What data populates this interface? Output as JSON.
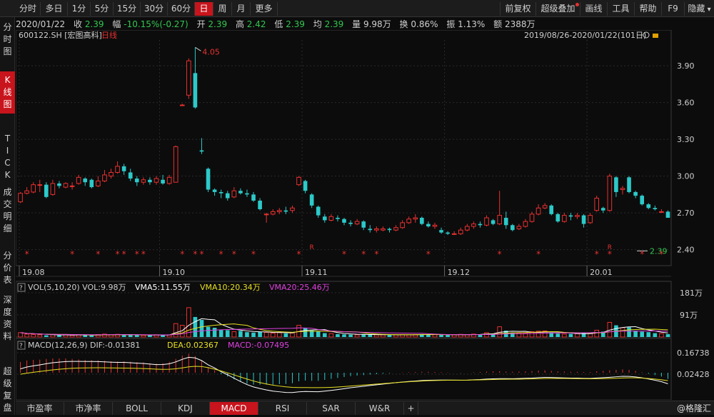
{
  "toolbar": {
    "left": [
      {
        "label": "分时",
        "active": false
      },
      {
        "label": "多日",
        "active": false
      },
      {
        "label": "1分",
        "active": false
      },
      {
        "label": "5分",
        "active": false
      },
      {
        "label": "15分",
        "active": false
      },
      {
        "label": "30分",
        "active": false
      },
      {
        "label": "60分",
        "active": false
      },
      {
        "label": "日",
        "active": true
      },
      {
        "label": "周",
        "active": false
      },
      {
        "label": "月",
        "active": false
      },
      {
        "label": "更多",
        "active": false
      }
    ],
    "right": [
      {
        "label": "前复权"
      },
      {
        "label": "超级叠加"
      },
      {
        "label": "画线"
      },
      {
        "label": "工具"
      },
      {
        "label": "帮助"
      },
      {
        "label": "F9"
      },
      {
        "label": "隐藏"
      }
    ]
  },
  "sidebar": [
    {
      "label": "分时图",
      "active": false
    },
    {
      "label": "K线图",
      "active": true
    },
    {
      "label": "TICK",
      "active": false
    },
    {
      "label": "成交明细",
      "active": false
    },
    {
      "label": "分价表",
      "active": false
    },
    {
      "label": "深度资料",
      "active": false
    },
    {
      "label": "超级复盘",
      "active": false
    }
  ],
  "info": {
    "date": "2020/01/22",
    "close_label": "收",
    "close": "2.39",
    "change_label": "幅",
    "change": "-10.15%(-0.27)",
    "open_label": "开",
    "open": "2.39",
    "high_label": "高",
    "high": "2.42",
    "low_label": "低",
    "low": "2.39",
    "avg_label": "均",
    "avg": "2.39",
    "vol_label": "量",
    "vol": "9.98万",
    "turnover_label": "换",
    "turnover": "0.86%",
    "amp_label": "振",
    "amp": "1.13%",
    "amount_label": "额",
    "amount": "2388万"
  },
  "price_panel": {
    "code": "600122.SH",
    "name": "[宏图高科]",
    "period": "日线",
    "range": "2019/08/26-2020/01/22(101日)",
    "peak_label": "4.05",
    "last_label": "2.39",
    "event_marker_r": "R",
    "event_marker_star": "*"
  },
  "vol_header": {
    "title": "VOL(5,10,20)",
    "vol": "VOL:9.98万",
    "vma5": "VMA5:11.55万",
    "vma10": "VMA10:20.34万",
    "vma20": "VMA20:25.46万"
  },
  "macd_header": {
    "title": "MACD(12,26,9)",
    "dif": "DIF:-0.01381",
    "dea": "DEA:0.02367",
    "macd": "MACD:-0.07495"
  },
  "bottom_tabs": [
    {
      "label": "市盈率",
      "active": false
    },
    {
      "label": "市净率",
      "active": false
    },
    {
      "label": "BOLL",
      "active": false
    },
    {
      "label": "KDJ",
      "active": false
    },
    {
      "label": "MACD",
      "active": true
    },
    {
      "label": "RSI",
      "active": false
    },
    {
      "label": "SAR",
      "active": false
    },
    {
      "label": "W&R",
      "active": false
    }
  ],
  "watermark": "@格隆汇",
  "colors": {
    "up": "#e83030",
    "down": "#2dc9c9",
    "active": "#c8141c",
    "green": "#32c650"
  },
  "chart_data": [
    {
      "type": "candlestick",
      "title": "600122.SH [宏图高科] 日线",
      "x_labels": [
        "19.08",
        "19.10",
        "19.11",
        "19.12",
        "20.01"
      ],
      "y_ticks": [
        "3.90",
        "3.60",
        "3.30",
        "3.00",
        "2.70",
        "2.40"
      ],
      "ylim": [
        2.27,
        4.11
      ],
      "candles": [
        [
          2.79,
          2.86,
          2.78,
          2.87
        ],
        [
          2.86,
          2.88,
          2.85,
          2.91
        ],
        [
          2.87,
          2.93,
          2.86,
          2.95
        ],
        [
          2.93,
          2.93,
          2.87,
          2.97
        ],
        [
          2.93,
          2.83,
          2.82,
          2.95
        ],
        [
          2.85,
          2.94,
          2.84,
          2.97
        ],
        [
          2.94,
          2.92,
          2.9,
          2.96
        ],
        [
          2.91,
          2.94,
          2.9,
          2.95
        ],
        [
          2.92,
          2.92,
          2.89,
          2.95
        ],
        [
          2.94,
          2.99,
          2.93,
          3.01
        ],
        [
          2.98,
          2.95,
          2.92,
          2.99
        ],
        [
          2.97,
          2.91,
          2.9,
          2.98
        ],
        [
          2.92,
          2.96,
          2.91,
          3.0
        ],
        [
          2.96,
          3.01,
          2.95,
          3.05
        ],
        [
          3.0,
          3.03,
          2.98,
          3.06
        ],
        [
          3.03,
          3.08,
          3.02,
          3.12
        ],
        [
          3.08,
          3.04,
          3.01,
          3.1
        ],
        [
          3.03,
          2.98,
          2.96,
          3.06
        ],
        [
          2.98,
          2.95,
          2.92,
          3.0
        ],
        [
          2.95,
          2.97,
          2.93,
          2.99
        ],
        [
          2.97,
          2.95,
          2.93,
          2.99
        ],
        [
          2.95,
          2.98,
          2.93,
          3.0
        ],
        [
          2.97,
          2.94,
          2.93,
          3.01
        ],
        [
          2.94,
          2.99,
          2.93,
          3.01
        ],
        [
          2.95,
          3.24,
          2.95,
          3.25
        ],
        [
          3.58,
          3.58,
          3.58,
          3.59
        ],
        [
          3.66,
          3.94,
          3.63,
          3.96
        ],
        [
          3.84,
          3.56,
          3.55,
          4.05
        ],
        [
          3.21,
          3.2,
          3.18,
          3.31
        ],
        [
          3.06,
          2.89,
          2.87,
          3.07
        ],
        [
          2.89,
          2.87,
          2.84,
          2.9
        ],
        [
          2.87,
          2.86,
          2.82,
          2.89
        ],
        [
          2.86,
          2.82,
          2.8,
          2.88
        ],
        [
          2.83,
          2.88,
          2.82,
          2.91
        ],
        [
          2.88,
          2.86,
          2.85,
          2.9
        ],
        [
          2.86,
          2.85,
          2.83,
          2.89
        ],
        [
          2.85,
          2.8,
          2.79,
          2.87
        ],
        [
          2.8,
          2.73,
          2.72,
          2.82
        ],
        [
          2.69,
          2.69,
          2.62,
          2.7
        ],
        [
          2.69,
          2.71,
          2.68,
          2.73
        ],
        [
          2.71,
          2.72,
          2.69,
          2.74
        ],
        [
          2.72,
          2.71,
          2.69,
          2.75
        ],
        [
          2.72,
          2.74,
          2.7,
          2.76
        ],
        [
          2.93,
          2.99,
          2.92,
          3.0
        ],
        [
          2.96,
          2.88,
          2.86,
          2.97
        ],
        [
          2.85,
          2.76,
          2.74,
          2.86
        ],
        [
          2.75,
          2.68,
          2.66,
          2.76
        ],
        [
          2.67,
          2.64,
          2.62,
          2.69
        ],
        [
          2.64,
          2.67,
          2.63,
          2.69
        ],
        [
          2.66,
          2.65,
          2.63,
          2.68
        ],
        [
          2.65,
          2.62,
          2.6,
          2.66
        ],
        [
          2.62,
          2.61,
          2.59,
          2.64
        ],
        [
          2.61,
          2.63,
          2.6,
          2.65
        ],
        [
          2.63,
          2.58,
          2.56,
          2.64
        ],
        [
          2.57,
          2.56,
          2.54,
          2.6
        ],
        [
          2.56,
          2.57,
          2.54,
          2.59
        ],
        [
          2.56,
          2.57,
          2.55,
          2.59
        ],
        [
          2.57,
          2.56,
          2.54,
          2.58
        ],
        [
          2.56,
          2.58,
          2.55,
          2.6
        ],
        [
          2.58,
          2.62,
          2.57,
          2.64
        ],
        [
          2.62,
          2.65,
          2.61,
          2.67
        ],
        [
          2.65,
          2.66,
          2.62,
          2.69
        ],
        [
          2.66,
          2.61,
          2.6,
          2.67
        ],
        [
          2.61,
          2.59,
          2.58,
          2.63
        ],
        [
          2.59,
          2.6,
          2.57,
          2.62
        ],
        [
          2.56,
          2.54,
          2.53,
          2.58
        ],
        [
          2.54,
          2.53,
          2.52,
          2.55
        ],
        [
          2.53,
          2.53,
          2.52,
          2.55
        ],
        [
          2.53,
          2.56,
          2.52,
          2.58
        ],
        [
          2.56,
          2.59,
          2.55,
          2.61
        ],
        [
          2.59,
          2.61,
          2.57,
          2.63
        ],
        [
          2.61,
          2.6,
          2.58,
          2.63
        ],
        [
          2.6,
          2.66,
          2.59,
          2.68
        ],
        [
          2.64,
          2.61,
          2.6,
          2.65
        ],
        [
          2.61,
          2.68,
          2.6,
          2.88
        ],
        [
          2.66,
          2.6,
          2.57,
          2.71
        ],
        [
          2.6,
          2.56,
          2.55,
          2.61
        ],
        [
          2.57,
          2.59,
          2.56,
          2.61
        ],
        [
          2.59,
          2.63,
          2.58,
          2.65
        ],
        [
          2.63,
          2.69,
          2.62,
          2.71
        ],
        [
          2.69,
          2.74,
          2.68,
          2.77
        ],
        [
          2.74,
          2.76,
          2.73,
          2.78
        ],
        [
          2.76,
          2.69,
          2.68,
          2.77
        ],
        [
          2.69,
          2.63,
          2.62,
          2.7
        ],
        [
          2.63,
          2.68,
          2.62,
          2.7
        ],
        [
          2.68,
          2.67,
          2.64,
          2.7
        ],
        [
          2.67,
          2.68,
          2.65,
          2.7
        ],
        [
          2.68,
          2.61,
          2.58,
          2.69
        ],
        [
          2.62,
          2.68,
          2.61,
          2.7
        ],
        [
          2.72,
          2.82,
          2.71,
          2.84
        ],
        [
          2.74,
          2.72,
          2.7,
          2.75
        ],
        [
          2.72,
          3.0,
          2.71,
          3.02
        ],
        [
          2.99,
          2.87,
          2.83,
          3.0
        ],
        [
          2.89,
          2.9,
          2.85,
          2.92
        ],
        [
          2.99,
          2.87,
          2.86,
          3.0
        ],
        [
          2.87,
          2.84,
          2.82,
          2.88
        ],
        [
          2.84,
          2.77,
          2.76,
          2.85
        ],
        [
          2.77,
          2.74,
          2.73,
          2.78
        ],
        [
          2.74,
          2.73,
          2.72,
          2.76
        ],
        [
          2.71,
          2.71,
          2.7,
          2.73
        ],
        [
          2.71,
          2.66,
          2.66,
          2.72
        ]
      ],
      "star_marks": [
        1,
        8,
        12,
        15,
        16,
        18,
        19,
        25,
        27,
        28,
        31,
        33,
        36,
        43,
        50,
        53,
        55,
        63,
        74,
        80,
        89,
        91,
        96,
        99
      ],
      "r_marks": [
        45,
        91
      ]
    },
    {
      "type": "bar",
      "title": "VOL(5,10,20)",
      "y_ticks": [
        "181万",
        "91万"
      ],
      "ylim": [
        0,
        181
      ],
      "unit": "万",
      "values": [
        18,
        12,
        10,
        9,
        7,
        10,
        8,
        10,
        7,
        9,
        8,
        7,
        10,
        12,
        9,
        11,
        8,
        9,
        8,
        7,
        8,
        9,
        8,
        9,
        55,
        48,
        120,
        82,
        70,
        42,
        38,
        30,
        28,
        22,
        25,
        20,
        18,
        22,
        19,
        16,
        18,
        15,
        17,
        48,
        38,
        27,
        22,
        16,
        14,
        12,
        11,
        10,
        9,
        11,
        10,
        9,
        9,
        8,
        9,
        10,
        9,
        10,
        12,
        11,
        10,
        9,
        8,
        9,
        11,
        10,
        12,
        11,
        18,
        14,
        42,
        26,
        18,
        15,
        16,
        22,
        24,
        25,
        18,
        14,
        12,
        13,
        14,
        16,
        15,
        28,
        22,
        60,
        48,
        38,
        40,
        26,
        22,
        20,
        16,
        14,
        12
      ]
    },
    {
      "type": "bar",
      "title": "MACD(12,26,9)",
      "y_ticks": [
        "0.16738",
        "0.02428"
      ],
      "values": [
        0.045,
        0.052,
        0.054,
        0.055,
        0.058,
        0.06,
        0.06,
        0.06,
        0.058,
        0.056,
        0.054,
        0.053,
        0.052,
        0.05,
        0.048,
        0.047,
        0.048,
        0.046,
        0.044,
        0.043,
        0.04,
        0.038,
        0.04,
        0.046,
        0.058,
        0.072,
        0.08,
        0.07,
        0.05,
        0.024,
        0.01,
        -0.006,
        -0.016,
        -0.028,
        -0.038,
        -0.046,
        -0.05,
        -0.05,
        -0.05,
        -0.05,
        -0.048,
        -0.047,
        -0.044,
        -0.036,
        -0.033,
        -0.034,
        -0.034,
        -0.03,
        -0.026,
        -0.022,
        -0.018,
        -0.014,
        -0.012,
        -0.01,
        -0.008,
        -0.006,
        -0.004,
        -0.002,
        0,
        0.001,
        0.002,
        0.003,
        0.004,
        0.004,
        0.003,
        0.002,
        0.001,
        0,
        -0.001,
        0,
        0.002,
        0.003,
        0.005,
        0.006,
        0.006,
        0.005,
        0.004,
        0.005,
        0.006,
        0.007,
        0.009,
        0.01,
        0.008,
        0.006,
        0.005,
        0.004,
        0.004,
        0.003,
        0.003,
        0.006,
        0.008,
        0.01,
        0.012,
        0.014,
        0.012,
        0.008,
        0.002,
        -0.004,
        -0.01,
        -0.016,
        -0.026
      ]
    }
  ]
}
